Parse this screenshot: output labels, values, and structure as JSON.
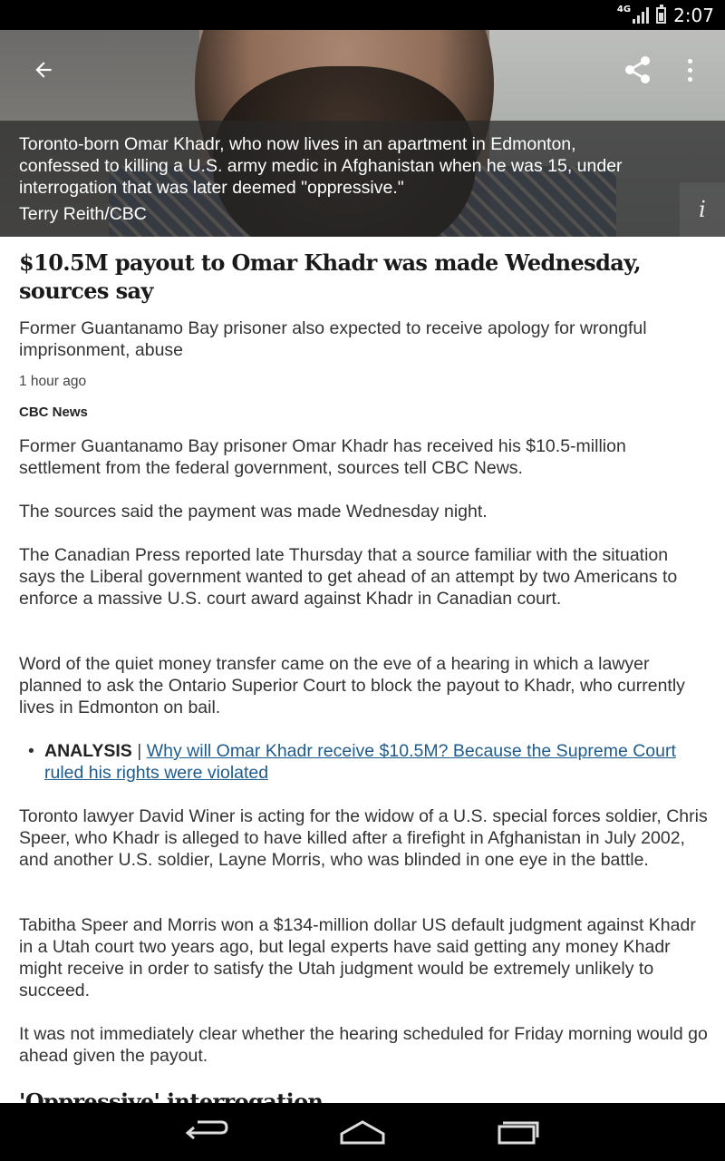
{
  "status_bar": {
    "network": "4G",
    "time": "2:07"
  },
  "hero": {
    "caption": "Toronto-born Omar Khadr, who now lives in an apartment in Edmonton, confessed to killing a U.S. army medic in Afghanistan when he was 15, under interrogation that was later deemed \"oppressive.\"",
    "credit": "Terry Reith/CBC",
    "info_label": "i"
  },
  "toolbar": {
    "back_icon": "arrow-back-icon",
    "share_icon": "share-icon",
    "overflow_icon": "more-vert-icon"
  },
  "article": {
    "headline": "$10.5M payout to Omar Khadr was made Wednesday, sources say",
    "deck": "Former Guantanamo Bay prisoner also expected to receive apology for wrongful imprisonment, abuse",
    "timestamp": "1 hour ago",
    "source": "CBC News",
    "paragraphs": [
      "Former Guantanamo Bay prisoner Omar Khadr has received his $10.5-million settlement from the federal government, sources tell CBC News.",
      "The sources said the payment was made Wednesday night.",
      "The Canadian Press reported late Thursday that a source familiar with the situation says the Liberal government wanted to get ahead of an attempt by two Americans to enforce a massive U.S. court award against Khadr in Canadian court.",
      "Word of the quiet money transfer came on the eve of a hearing in which a lawyer planned to ask the Ontario Superior Court to block the payout to Khadr, who currently lives in Edmonton on bail.",
      "Toronto lawyer David Winer is acting for the widow of a U.S. special forces soldier, Chris Speer, who Khadr is alleged to have killed after a firefight in Afghanistan in July 2002, and another U.S. soldier, Layne Morris, who was blinded in one eye in the battle.",
      "Tabitha Speer and Morris won a $134-million dollar US default judgment against Khadr in a Utah court two years ago, but legal experts have said getting any money Khadr might receive in order to satisfy the Utah judgment would be extremely unlikely to succeed.",
      "It was not immediately clear whether the hearing scheduled for Friday morning would go ahead given the payout."
    ],
    "related": {
      "label": "ANALYSIS",
      "separator": "|",
      "link_text": "Why will Omar Khadr receive $10.5M? Because the Supreme Court ruled his rights were violated"
    },
    "subheading": "'Oppressive' interrogation"
  },
  "nav_bar": {
    "back": "nav-back-icon",
    "home": "nav-home-icon",
    "recents": "nav-recents-icon"
  },
  "colors": {
    "link": "#1d5b8c",
    "status_bar_bg": "#000000",
    "caption_overlay": "rgba(40,40,40,0.72)"
  }
}
